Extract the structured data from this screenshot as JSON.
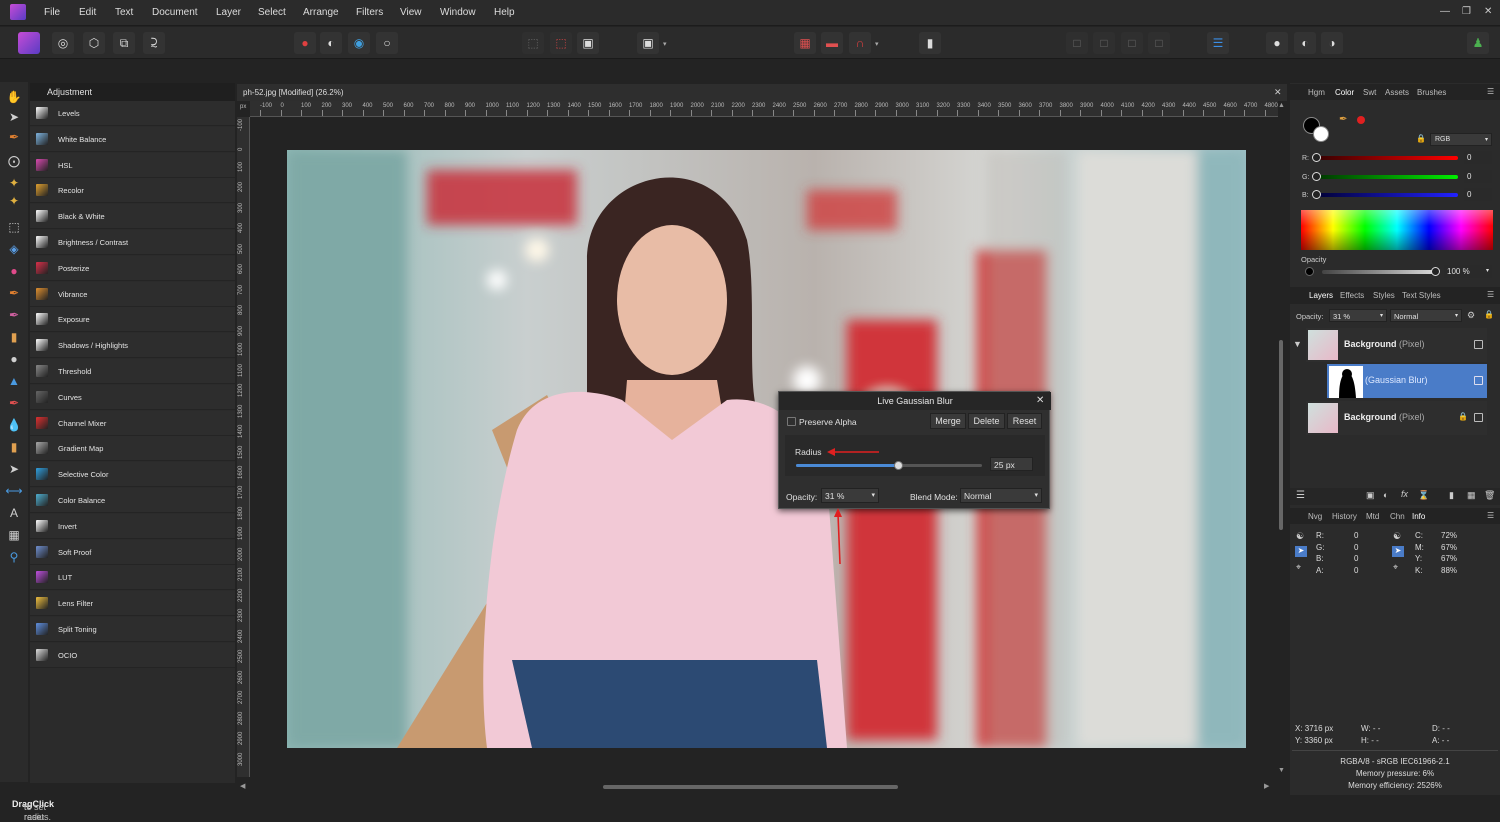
{
  "menubar": {
    "items": [
      "File",
      "Edit",
      "Text",
      "Document",
      "Layer",
      "Select",
      "Arrange",
      "Filters",
      "View",
      "Window",
      "Help"
    ]
  },
  "adjustments": {
    "header": "Adjustment",
    "items": [
      {
        "label": "Levels",
        "icon": "levels-icon",
        "color": "#ffffff"
      },
      {
        "label": "White Balance",
        "icon": "white-balance-icon",
        "color": "#7fb5e0"
      },
      {
        "label": "HSL",
        "icon": "hsl-icon",
        "color": "#d94ab0"
      },
      {
        "label": "Recolor",
        "icon": "recolor-icon",
        "color": "#e0a030"
      },
      {
        "label": "Black & White",
        "icon": "black-white-icon",
        "color": "#ffffff"
      },
      {
        "label": "Brightness / Contrast",
        "icon": "brightness-contrast-icon",
        "color": "#ffffff"
      },
      {
        "label": "Posterize",
        "icon": "posterize-icon",
        "color": "#d9304a"
      },
      {
        "label": "Vibrance",
        "icon": "vibrance-icon",
        "color": "#e09030"
      },
      {
        "label": "Exposure",
        "icon": "exposure-icon",
        "color": "#ffffff"
      },
      {
        "label": "Shadows / Highlights",
        "icon": "shadows-highlights-icon",
        "color": "#ffffff"
      },
      {
        "label": "Threshold",
        "icon": "threshold-icon",
        "color": "#888888"
      },
      {
        "label": "Curves",
        "icon": "curves-icon",
        "color": "#666666"
      },
      {
        "label": "Channel Mixer",
        "icon": "channel-mixer-icon",
        "color": "#e03030"
      },
      {
        "label": "Gradient Map",
        "icon": "gradient-map-icon",
        "color": "#aaaaaa"
      },
      {
        "label": "Selective Color",
        "icon": "selective-color-icon",
        "color": "#30a0e0"
      },
      {
        "label": "Color Balance",
        "icon": "color-balance-icon",
        "color": "#50b0d0"
      },
      {
        "label": "Invert",
        "icon": "invert-icon",
        "color": "#ffffff"
      },
      {
        "label": "Soft Proof",
        "icon": "soft-proof-icon",
        "color": "#7090d0"
      },
      {
        "label": "LUT",
        "icon": "lut-icon",
        "color": "#c050e0"
      },
      {
        "label": "Lens Filter",
        "icon": "lens-filter-icon",
        "color": "#f0c040"
      },
      {
        "label": "Split Toning",
        "icon": "split-toning-icon",
        "color": "#6090e0"
      },
      {
        "label": "OCIO",
        "icon": "ocio-icon",
        "color": "#dddddd"
      }
    ]
  },
  "document": {
    "tab_title": "ph-52.jpg [Modified] (26.2%)",
    "ruler_unit": "px",
    "ruler_top": [
      "-100",
      "0",
      "100",
      "200",
      "300",
      "400",
      "500",
      "600",
      "700",
      "800",
      "900",
      "1000",
      "1100",
      "1200",
      "1300",
      "1400",
      "1500",
      "1600",
      "1700",
      "1800",
      "1900",
      "2000",
      "2100",
      "2200",
      "2300",
      "2400",
      "2500",
      "2600",
      "2700",
      "2800",
      "2900",
      "3000",
      "3100",
      "3200",
      "3300",
      "3400",
      "3500",
      "3600",
      "3700",
      "3800",
      "3900",
      "4000",
      "4100",
      "4200",
      "4300",
      "4400",
      "4500",
      "4600",
      "4700",
      "4800"
    ],
    "ruler_left": [
      "-100",
      "0",
      "100",
      "200",
      "300",
      "400",
      "500",
      "600",
      "700",
      "800",
      "900",
      "1000",
      "1100",
      "1200",
      "1300",
      "1400",
      "1500",
      "1600",
      "1700",
      "1800",
      "1900",
      "2000",
      "2100",
      "2200",
      "2300",
      "2400",
      "2500",
      "2600",
      "2700",
      "2800",
      "2900",
      "3000"
    ]
  },
  "dialog": {
    "title": "Live Gaussian Blur",
    "preserve_alpha": "Preserve Alpha",
    "merge": "Merge",
    "delete": "Delete",
    "reset": "Reset",
    "radius_label": "Radius",
    "radius_value": "25 px",
    "radius_fraction": 0.55,
    "opacity_label": "Opacity:",
    "opacity_value": "31 %",
    "blend_label": "Blend Mode:",
    "blend_value": "Normal"
  },
  "color_panel": {
    "tabs": [
      "Hgm",
      "Color",
      "Swt",
      "Assets",
      "Brushes"
    ],
    "active": "Color",
    "model": "RGB",
    "r_label": "R:",
    "r_value": "0",
    "g_label": "G:",
    "g_value": "0",
    "b_label": "B:",
    "b_value": "0",
    "opacity_label": "Opacity",
    "opacity_value": "100 %"
  },
  "layers_panel": {
    "tabs": [
      "Layers",
      "Effects",
      "Styles",
      "Text Styles"
    ],
    "opacity_label": "Opacity:",
    "opacity_value": "31 %",
    "blend_value": "Normal",
    "layers": [
      {
        "name": "Background",
        "type": "(Pixel)"
      },
      {
        "name": "(Gaussian Blur)",
        "type": ""
      },
      {
        "name": "Background",
        "type": "(Pixel)"
      }
    ]
  },
  "info_panel": {
    "tabs": [
      "Nvg",
      "History",
      "Mtd",
      "Chn",
      "Info"
    ],
    "active": "Info",
    "rgba": [
      [
        "R:",
        "0"
      ],
      [
        "G:",
        "0"
      ],
      [
        "B:",
        "0"
      ],
      [
        "A:",
        "0"
      ]
    ],
    "cmyk": [
      [
        "C:",
        "72%"
      ],
      [
        "M:",
        "67%"
      ],
      [
        "Y:",
        "67%"
      ],
      [
        "K:",
        "88%"
      ]
    ],
    "x": "X: 3716 px",
    "y": "Y: 3360 px",
    "w": "W: - -",
    "h": "H: - -",
    "d": "D: - -",
    "a": "A: - -",
    "profile": "RGBA/8 - sRGB IEC61966-2.1",
    "pressure": "Memory pressure: 6%",
    "efficiency": "Memory efficiency: 2526%"
  },
  "status": {
    "bold1": "Drag",
    "text1": " to set radius. ",
    "bold2": "Click",
    "text2": " to reset."
  }
}
